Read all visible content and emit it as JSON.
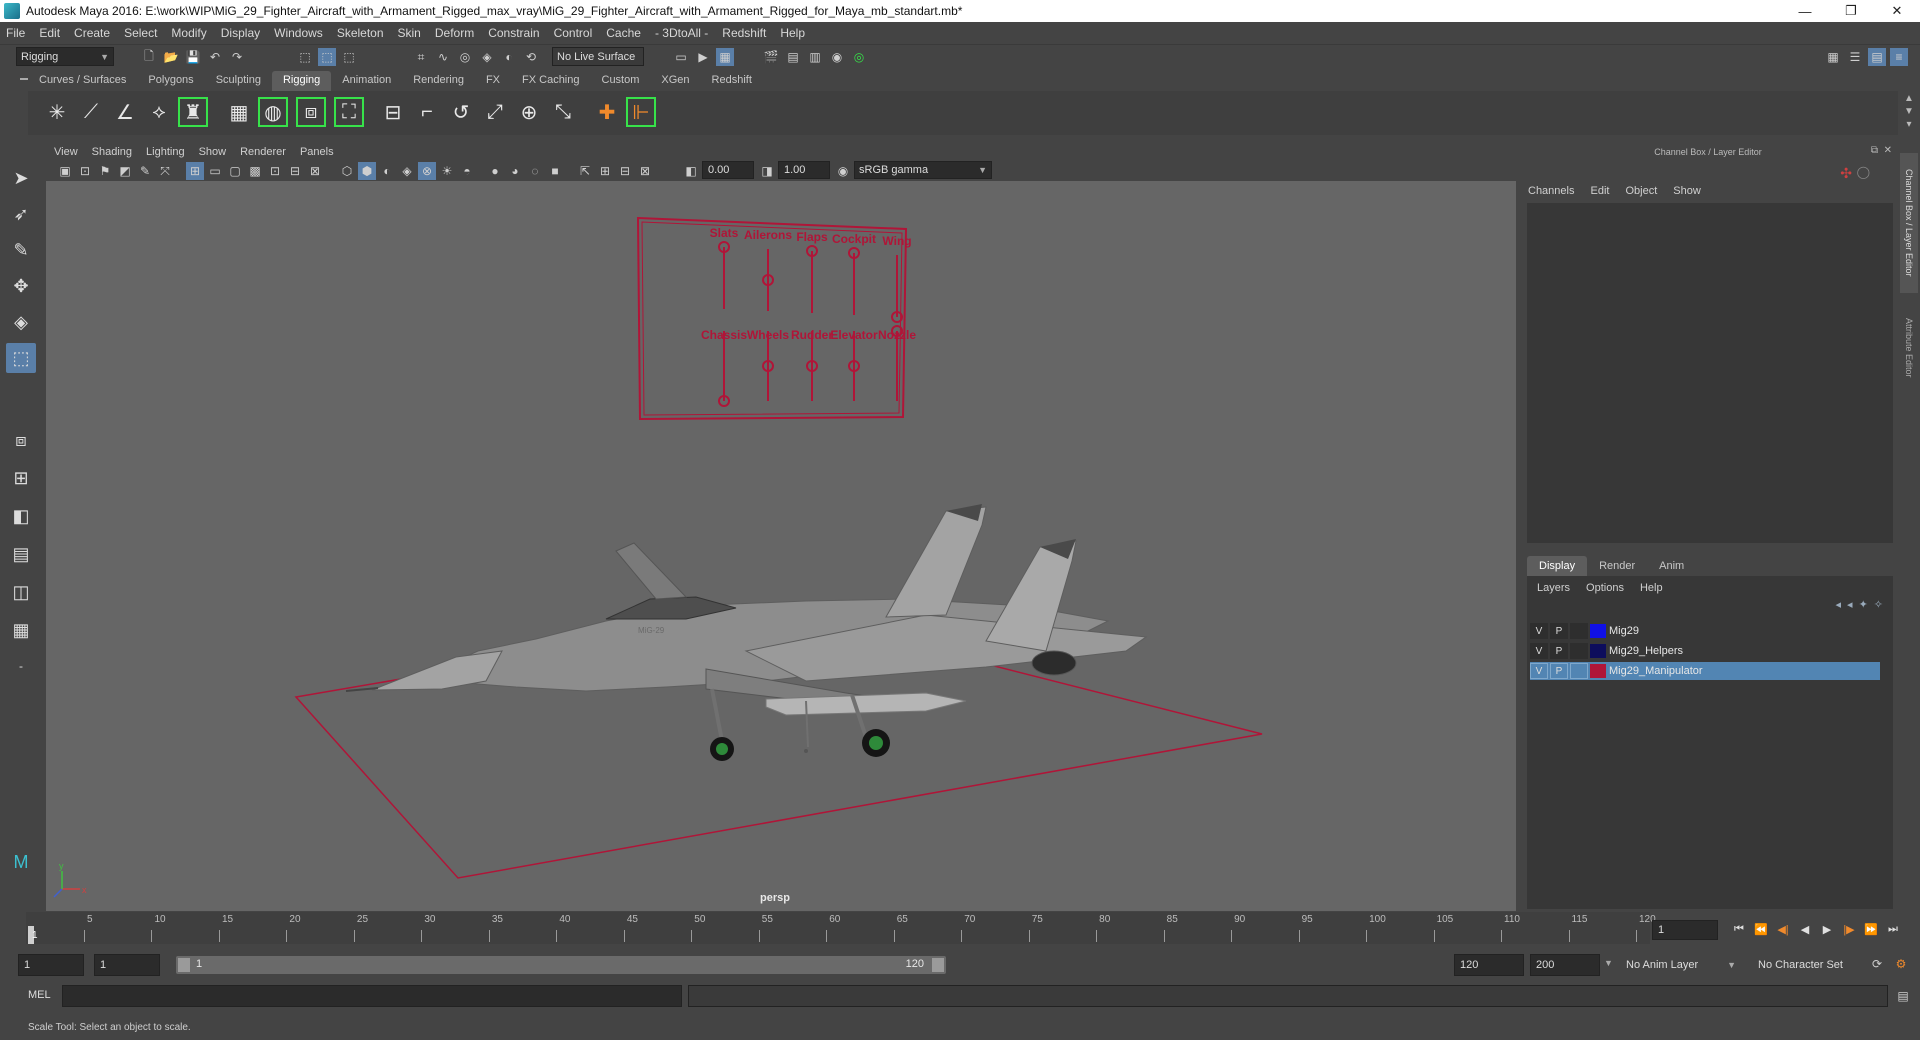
{
  "window": {
    "title": "Autodesk Maya 2016: E:\\work\\WIP\\MiG_29_Fighter_Aircraft_with_Armament_Rigged_max_vray\\MiG_29_Fighter_Aircraft_with_Armament_Rigged_for_Maya_mb_standart.mb*",
    "minimize": "—",
    "restore": "❐",
    "close": "✕"
  },
  "menu": [
    "File",
    "Edit",
    "Create",
    "Select",
    "Modify",
    "Display",
    "Windows",
    "Skeleton",
    "Skin",
    "Deform",
    "Constrain",
    "Control",
    "Cache",
    "- 3DtoAll -",
    "Redshift",
    "Help"
  ],
  "statusline": {
    "menuset": "Rigging",
    "live_surface": "No Live Surface"
  },
  "shelf": {
    "tabs": [
      "Curves / Surfaces",
      "Polygons",
      "Sculpting",
      "Rigging",
      "Animation",
      "Rendering",
      "FX",
      "FX Caching",
      "Custom",
      "XGen",
      "Redshift"
    ],
    "active_tab": "Rigging"
  },
  "viewport": {
    "menu": [
      "View",
      "Shading",
      "Lighting",
      "Show",
      "Renderer",
      "Panels"
    ],
    "exposure": "0.00",
    "gamma": "1.00",
    "color_space": "sRGB gamma",
    "camera_label": "persp",
    "rig_panel": {
      "top_labels": [
        "Slats",
        "Ailerons",
        "Flaps",
        "Cockpit",
        "Wing"
      ],
      "bottom_labels": [
        "Chassis",
        "Wheels",
        "Rudder",
        "Elevator",
        "Nozzle"
      ],
      "slider_levels_top": [
        0.0,
        0.5,
        0.0,
        0.0,
        1.0
      ],
      "slider_levels_bottom": [
        1.0,
        0.5,
        0.5,
        0.5,
        0.0
      ]
    },
    "aircraft_marking": "MiG-29",
    "axis_labels": {
      "x": "x",
      "y": "y"
    }
  },
  "channel_box": {
    "title": "Channel Box / Layer Editor",
    "menu": [
      "Channels",
      "Edit",
      "Object",
      "Show"
    ]
  },
  "layer_editor": {
    "tabs": [
      "Display",
      "Render",
      "Anim"
    ],
    "active_tab": "Display",
    "menu": [
      "Layers",
      "Options",
      "Help"
    ],
    "layers": [
      {
        "v": "V",
        "p": "P",
        "name": "Mig29",
        "color": "#1010e6",
        "selected": false
      },
      {
        "v": "V",
        "p": "P",
        "name": "Mig29_Helpers",
        "color": "#0d0d5c",
        "selected": false
      },
      {
        "v": "V",
        "p": "P",
        "name": "Mig29_Manipulator",
        "color": "#b01538",
        "selected": true
      }
    ]
  },
  "side_tabs": [
    "Channel Box / Layer Editor",
    "Attribute Editor"
  ],
  "timeline": {
    "ticks": [
      1,
      5,
      10,
      15,
      20,
      25,
      30,
      35,
      40,
      45,
      50,
      55,
      60,
      65,
      70,
      75,
      80,
      85,
      90,
      95,
      100,
      105,
      110,
      115,
      120
    ],
    "current_frame": "1",
    "playback_buttons": [
      "⏮",
      "⏪",
      "◀|",
      "◀",
      "▶",
      "|▶",
      "⏩",
      "⏭"
    ]
  },
  "range": {
    "start": "1",
    "playback_start": "1",
    "slider_start": "1",
    "slider_end": "120",
    "playback_end": "120",
    "end": "200",
    "anim_layer": "No Anim Layer",
    "character_set": "No Character Set"
  },
  "command_line": {
    "label": "MEL"
  },
  "help_line": "Scale Tool: Select an object to scale."
}
